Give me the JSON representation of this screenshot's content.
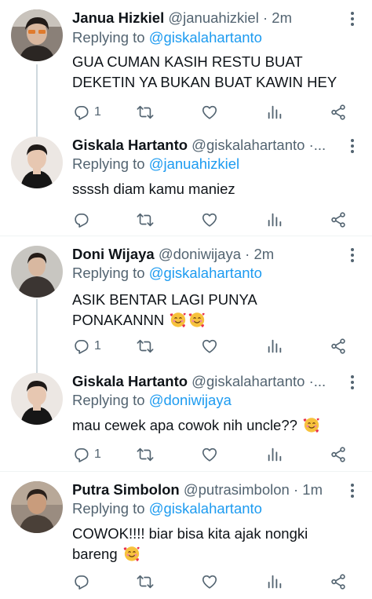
{
  "replying_label": "Replying to",
  "tweets": [
    {
      "name": "Janua Hizkiel",
      "handle": "@januahizkiel",
      "sep": "·",
      "time": "2m",
      "reply_to": "@giskalahartanto",
      "text": "GUA CUMAN KASIH RESTU BUAT DEKETIN YA BUKAN BUAT KAWIN HEY",
      "reply_count": "1"
    },
    {
      "name": "Giskala Hartanto",
      "handle": "@giskalahartanto",
      "sep": "·...",
      "time": "",
      "reply_to": "@januahizkiel",
      "text": "ssssh diam kamu maniez",
      "reply_count": ""
    },
    {
      "name": "Doni Wijaya",
      "handle": "@doniwijaya",
      "sep": "·",
      "time": "2m",
      "reply_to": "@giskalahartanto",
      "text": "ASIK BENTAR LAGI PUNYA PONAKANNN",
      "reply_count": "1"
    },
    {
      "name": "Giskala Hartanto",
      "handle": "@giskalahartanto",
      "sep": "·...",
      "time": "",
      "reply_to": "@doniwijaya",
      "text": "mau cewek apa cowok nih uncle??",
      "reply_count": "1"
    },
    {
      "name": "Putra Simbolon",
      "handle": "@putrasimbolon",
      "sep": "·",
      "time": "1m",
      "reply_to": "@giskalahartanto",
      "text": "COWOK!!!! biar bisa kita ajak nongki bareng",
      "reply_count": ""
    }
  ],
  "colors": {
    "link": "#1d9bf0",
    "secondary": "#536471",
    "thread_line": "#cfd9de",
    "divider": "#eff3f4"
  },
  "icons": [
    "reply-icon",
    "retweet-icon",
    "like-icon",
    "analytics-icon",
    "share-icon",
    "more-icon",
    "smiling-face-with-hearts-emoji"
  ]
}
